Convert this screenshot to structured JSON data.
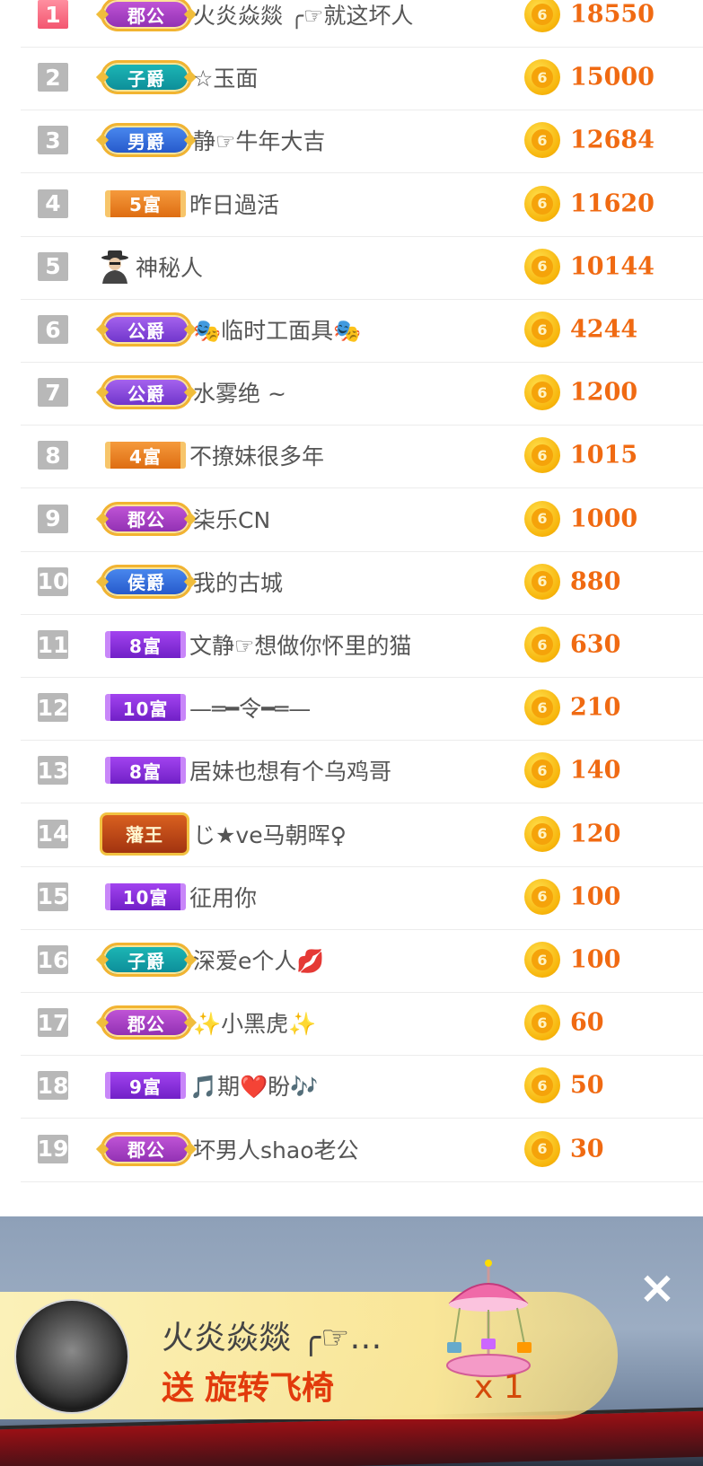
{
  "leaderboard": [
    {
      "rank": "1",
      "badge": {
        "kind": "noble",
        "color": "purple",
        "label": "郡公"
      },
      "name": "火炎焱燚 ╭☞就这坏人",
      "amount": "18550"
    },
    {
      "rank": "2",
      "badge": {
        "kind": "noble",
        "color": "teal",
        "label": "子爵"
      },
      "name": "☆玉面",
      "amount": "15000"
    },
    {
      "rank": "3",
      "badge": {
        "kind": "noble",
        "color": "blue",
        "label": "男爵"
      },
      "name": "静☞牛年大吉",
      "amount": "12684"
    },
    {
      "rank": "4",
      "badge": {
        "kind": "wealth",
        "color": "orange",
        "label": "5富"
      },
      "name": "昨日過活",
      "amount": "11620"
    },
    {
      "rank": "5",
      "badge": {
        "kind": "mystery",
        "color": "",
        "label": ""
      },
      "name": "神秘人",
      "amount": "10144"
    },
    {
      "rank": "6",
      "badge": {
        "kind": "noble",
        "color": "violet",
        "label": "公爵"
      },
      "name": "🎭临时工面具🎭",
      "amount": "4244"
    },
    {
      "rank": "7",
      "badge": {
        "kind": "noble",
        "color": "violet",
        "label": "公爵"
      },
      "name": "水雾绝 ~",
      "amount": "1200"
    },
    {
      "rank": "8",
      "badge": {
        "kind": "wealth",
        "color": "orange",
        "label": "4富"
      },
      "name": "不撩妹很多年",
      "amount": "1015"
    },
    {
      "rank": "9",
      "badge": {
        "kind": "noble",
        "color": "purple",
        "label": "郡公"
      },
      "name": "柒乐CN",
      "amount": "1000"
    },
    {
      "rank": "10",
      "badge": {
        "kind": "noble",
        "color": "blue",
        "label": "侯爵"
      },
      "name": "我的古城",
      "amount": "880"
    },
    {
      "rank": "11",
      "badge": {
        "kind": "wealth",
        "color": "purple",
        "label": "8富"
      },
      "name": "文静☞想做你怀里的猫",
      "amount": "630"
    },
    {
      "rank": "12",
      "badge": {
        "kind": "wealth",
        "color": "purple",
        "label": "10富"
      },
      "name": "—═━令━═—",
      "amount": "210"
    },
    {
      "rank": "13",
      "badge": {
        "kind": "wealth",
        "color": "purple",
        "label": "8富"
      },
      "name": "居妹也想有个乌鸡哥",
      "amount": "140"
    },
    {
      "rank": "14",
      "badge": {
        "kind": "king",
        "color": "",
        "label": "藩王"
      },
      "name": "じ★ve马朝晖♀",
      "amount": "120"
    },
    {
      "rank": "15",
      "badge": {
        "kind": "wealth",
        "color": "purple",
        "label": "10富"
      },
      "name": "征用你",
      "amount": "100"
    },
    {
      "rank": "16",
      "badge": {
        "kind": "noble",
        "color": "teal",
        "label": "子爵"
      },
      "name": "深爱e个人💋",
      "amount": "100"
    },
    {
      "rank": "17",
      "badge": {
        "kind": "noble",
        "color": "purple",
        "label": "郡公"
      },
      "name": "✨小黑虎✨",
      "amount": "60"
    },
    {
      "rank": "18",
      "badge": {
        "kind": "wealth",
        "color": "purple",
        "label": "9富"
      },
      "name": "🎵期❤️盼🎶",
      "amount": "50"
    },
    {
      "rank": "19",
      "badge": {
        "kind": "noble",
        "color": "purple",
        "label": "郡公"
      },
      "name": "坏男人shao老公",
      "amount": "30"
    }
  ],
  "coin_icon": "gold-coin-icon",
  "coin_glyph": "6",
  "gift_banner": {
    "sender": "火炎焱燚 ╭☞…",
    "verb": "送",
    "gift_name": "旋转飞椅",
    "count": "x 1",
    "gift_icon": "carousel-gift-icon"
  },
  "close_glyph": "×",
  "colors": {
    "amount": "#f06a12",
    "gift_action": "#e23a0c",
    "rank_top": "#f35670",
    "rank_default": "#b8b8b8"
  }
}
